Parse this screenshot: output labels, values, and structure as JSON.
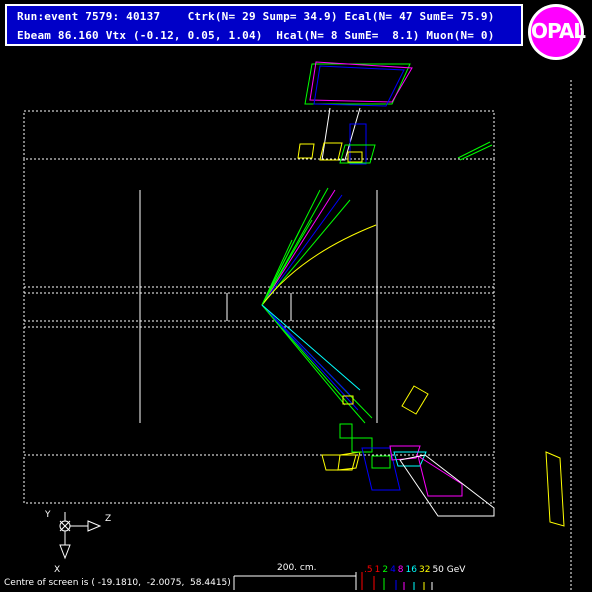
{
  "header": {
    "line1": "Run:event 7579: 40137    Ctrk(N= 29 Sump= 34.9) Ecal(N= 47 SumE= 75.9)",
    "line2": "Ebeam 86.160 Vtx (-0.12, 0.05, 1.04)  Hcal(N= 8 SumE=  8.1) Muon(N= 0)"
  },
  "logo": {
    "text": "OPAL",
    "color": "#ff00ff"
  },
  "axes": {
    "y": "Y",
    "z": "Z",
    "x": "X"
  },
  "footer": {
    "centre": "Centre of screen is ( -19.1810,  -2.0075,  58.4415)",
    "scale_label": "200. cm."
  },
  "energy_legend": {
    "items": [
      {
        "text": ".5",
        "color": "#ff0000"
      },
      {
        "text": "1",
        "color": "#ff0000"
      },
      {
        "text": "2",
        "color": "#00ff00"
      },
      {
        "text": "4",
        "color": "#0000ff"
      },
      {
        "text": "8",
        "color": "#ff00ff"
      },
      {
        "text": "16",
        "color": "#00ffff"
      },
      {
        "text": "32",
        "color": "#ffff00"
      },
      {
        "text": "50 GeV",
        "color": "#ffffff"
      }
    ]
  }
}
